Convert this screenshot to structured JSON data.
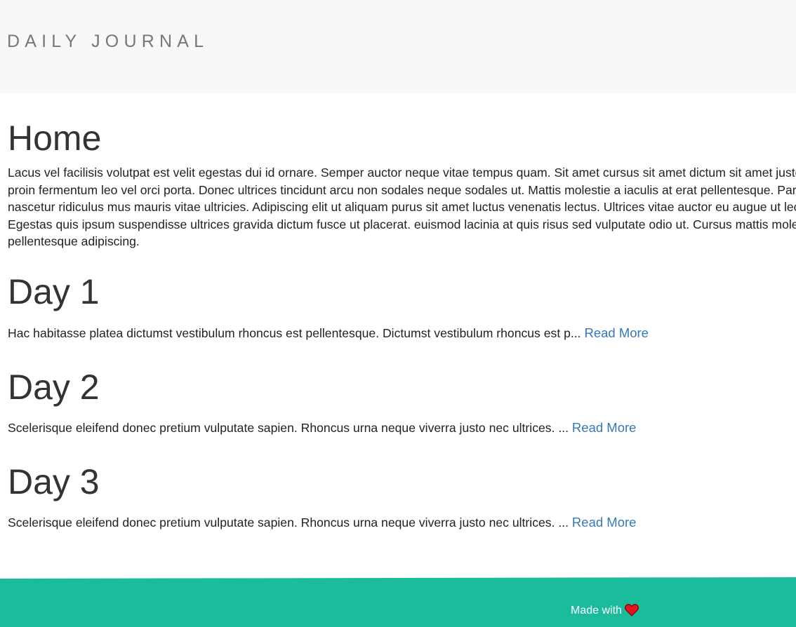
{
  "navbar": {
    "brand": "DAILY JOURNAL"
  },
  "home": {
    "title": "Home",
    "body": "Lacus vel facilisis volutpat est velit egestas dui id ornare. Semper auctor neque vitae tempus quam. Sit amet cursus sit amet dictum sit amet justo donec. Imperdiet proin fermentum leo vel orci porta. Donec ultrices tincidunt arcu non sodales neque sodales ut. Mattis molestie a iaculis at erat pellentesque. Parturient montes nascetur ridiculus mus mauris vitae ultricies. Adipiscing elit ut aliquam purus sit amet luctus venenatis lectus. Ultrices vitae auctor eu augue ut lectus arcu bibendum. Egestas quis ipsum suspendisse ultrices gravida dictum fusce ut placerat. euismod lacinia at quis risus sed vulputate odio ut. Cursus mattis molestie a iaculis at erat pellentesque adipiscing."
  },
  "posts": [
    {
      "title": "Day 1",
      "excerpt": "Hac habitasse platea dictumst vestibulum rhoncus est pellentesque. Dictumst vestibulum rhoncus est p... ",
      "read_more": "Read More"
    },
    {
      "title": "Day 2",
      "excerpt": "Scelerisque eleifend donec pretium vulputate sapien. Rhoncus urna neque viverra justo nec ultrices. ... ",
      "read_more": "Read More"
    },
    {
      "title": "Day 3",
      "excerpt": "Scelerisque eleifend donec pretium vulputate sapien. Rhoncus urna neque viverra justo nec ultrices. ... ",
      "read_more": "Read More"
    }
  ],
  "footer": {
    "text": "Made with",
    "icon": "heart-icon",
    "icon_color": "#e8111c",
    "background": "#1abc9c"
  }
}
